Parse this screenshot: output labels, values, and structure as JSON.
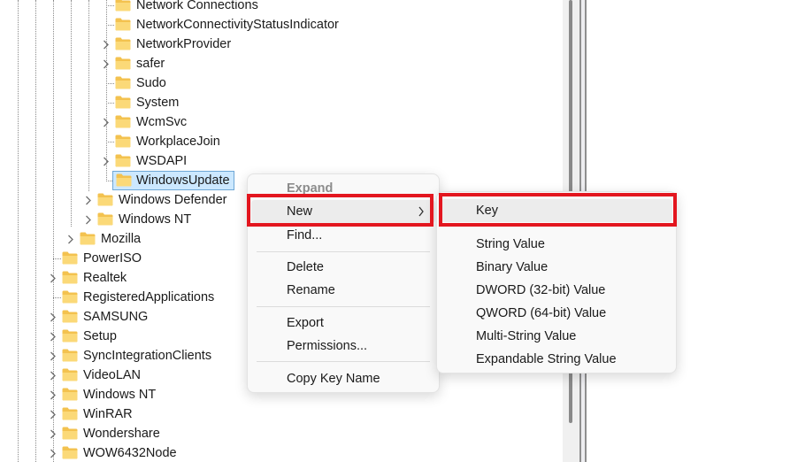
{
  "tree": {
    "items": [
      {
        "label": "Network Connections",
        "expandable": false
      },
      {
        "label": "NetworkConnectivityStatusIndicator",
        "expandable": false
      },
      {
        "label": "NetworkProvider",
        "expandable": true
      },
      {
        "label": "safer",
        "expandable": true
      },
      {
        "label": "Sudo",
        "expandable": false
      },
      {
        "label": "System",
        "expandable": false
      },
      {
        "label": "WcmSvc",
        "expandable": true
      },
      {
        "label": "WorkplaceJoin",
        "expandable": false
      },
      {
        "label": "WSDAPI",
        "expandable": true
      },
      {
        "label": "WindowsUpdate",
        "expandable": false,
        "selected": true
      },
      {
        "label": "Windows Defender",
        "expandable": true
      },
      {
        "label": "Windows NT",
        "expandable": true
      },
      {
        "label": "Mozilla",
        "expandable": true
      },
      {
        "label": "PowerISO",
        "expandable": false
      },
      {
        "label": "Realtek",
        "expandable": true
      },
      {
        "label": "RegisteredApplications",
        "expandable": false
      },
      {
        "label": "SAMSUNG",
        "expandable": true
      },
      {
        "label": "Setup",
        "expandable": true
      },
      {
        "label": "SyncIntegrationClients",
        "expandable": true
      },
      {
        "label": "VideoLAN",
        "expandable": true
      },
      {
        "label": "Windows NT",
        "expandable": true
      },
      {
        "label": "WinRAR",
        "expandable": true
      },
      {
        "label": "Wondershare",
        "expandable": true
      },
      {
        "label": "WOW6432Node",
        "expandable": true
      }
    ]
  },
  "context_menu": {
    "items": {
      "expand": "Expand",
      "new": "New",
      "new_arrow": "›",
      "find": "Find...",
      "delete": "Delete",
      "rename": "Rename",
      "export": "Export",
      "permissions": "Permissions...",
      "copy_key_name": "Copy Key Name"
    }
  },
  "new_submenu": {
    "items": {
      "key": "Key",
      "string_value": "String Value",
      "binary_value": "Binary Value",
      "dword_value": "DWORD (32-bit) Value",
      "qword_value": "QWORD (64-bit) Value",
      "multi_string_value": "Multi-String Value",
      "expandable_string_value": "Expandable String Value"
    }
  },
  "colors": {
    "highlight_annotation": "#e3161f",
    "selection_background": "#cce8ff",
    "folder": "#f8d775"
  }
}
